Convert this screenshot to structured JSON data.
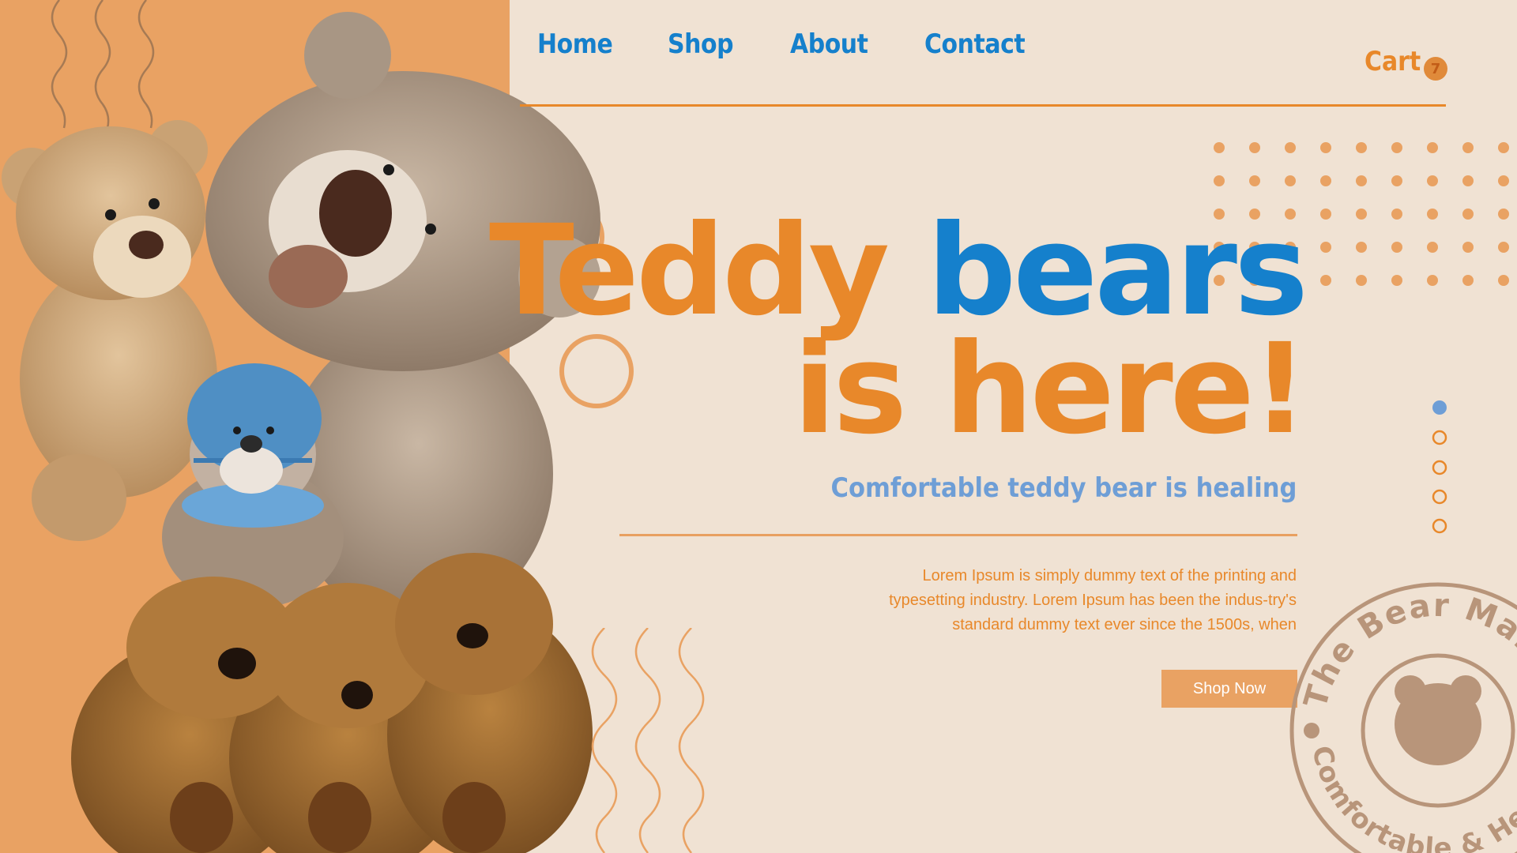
{
  "nav": {
    "items": [
      {
        "label": "Home"
      },
      {
        "label": "Shop"
      },
      {
        "label": "About"
      },
      {
        "label": "Contact"
      }
    ],
    "cart_label": "Cart",
    "cart_count": "7"
  },
  "hero": {
    "headline_word1": "Teddy",
    "headline_word2": "bears",
    "headline_line2": "is here!",
    "subtitle": "Comfortable teddy bear is healing",
    "body": "Lorem Ipsum is simply dummy text of the printing and typesetting industry. Lorem Ipsum has been the indus-try's standard dummy text ever since the 1500s, when",
    "cta_label": "Shop Now"
  },
  "stamp": {
    "title": "The Bear Market",
    "subtitle": "Comfortable & Healing"
  },
  "slider": {
    "count": 5,
    "active_index": 0
  },
  "colors": {
    "background": "#f0e2d3",
    "panel_orange": "#e9a263",
    "accent_orange": "#e8882a",
    "accent_blue": "#1580cc",
    "subtitle_blue": "#6e9ed6",
    "stamp_brown": "#b8957a"
  }
}
